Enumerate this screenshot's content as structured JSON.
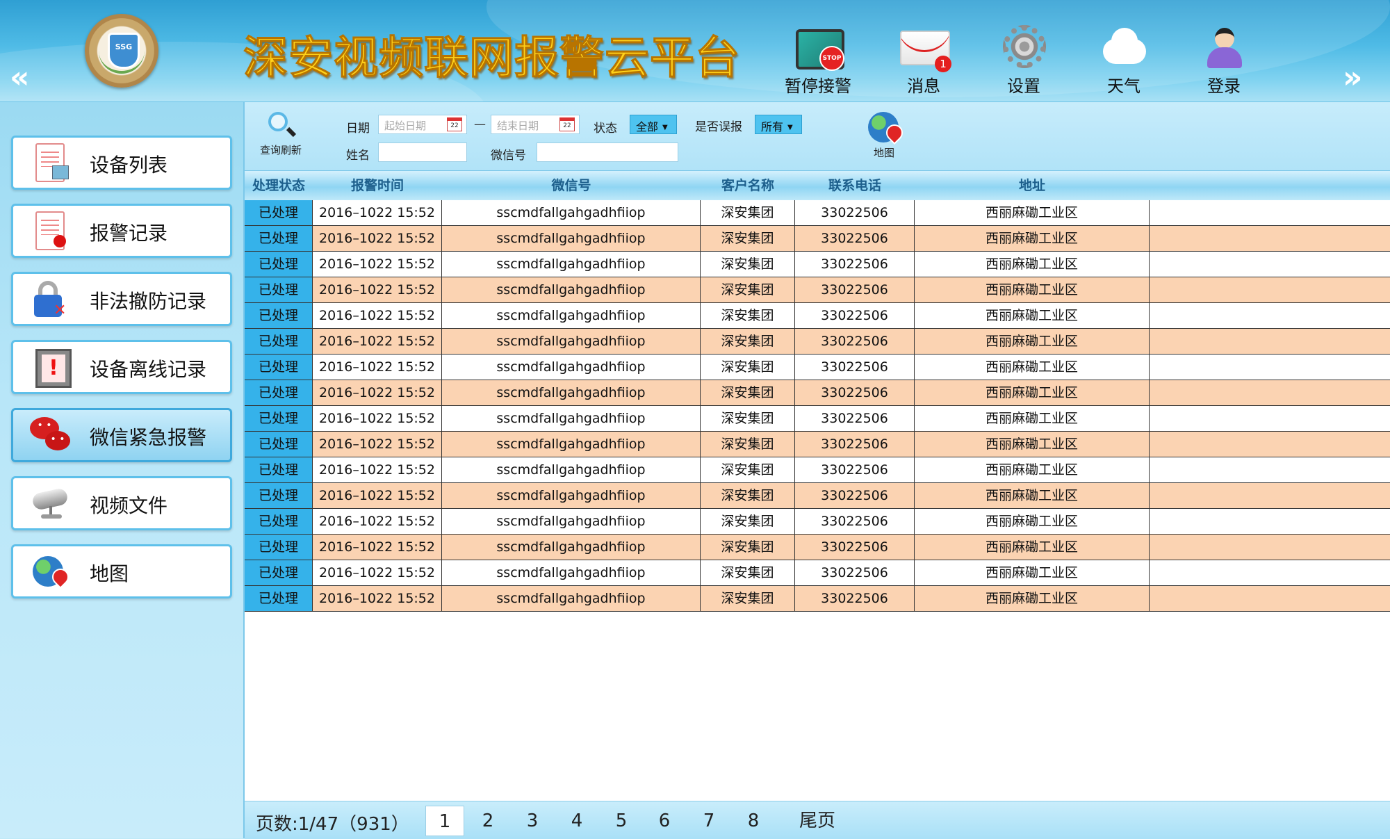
{
  "header": {
    "title": "深安视频联网报警云平台",
    "nav_prev": "«",
    "nav_next": "»",
    "buttons": [
      {
        "label": "暂停接警",
        "icon": "stop-screen-icon",
        "badge": "STOP"
      },
      {
        "label": "消息",
        "icon": "mail-icon",
        "count": "1"
      },
      {
        "label": "设置",
        "icon": "gear-icon"
      },
      {
        "label": "天气",
        "icon": "cloud-icon"
      },
      {
        "label": "登录",
        "icon": "user-icon"
      }
    ],
    "logo_text": "SSG"
  },
  "sidebar": {
    "items": [
      {
        "label": "设备列表",
        "icon": "device-list-icon"
      },
      {
        "label": "报警记录",
        "icon": "alarm-record-icon"
      },
      {
        "label": "非法撤防记录",
        "icon": "lock-icon"
      },
      {
        "label": "设备离线记录",
        "icon": "warning-icon"
      },
      {
        "label": "微信紧急报警",
        "icon": "chat-bubble-icon",
        "active": true
      },
      {
        "label": "视频文件",
        "icon": "camera-icon"
      },
      {
        "label": "地图",
        "icon": "globe-icon"
      }
    ]
  },
  "filters": {
    "refresh_label": "查询刷新",
    "date_label": "日期",
    "start_placeholder": "起始日期",
    "end_placeholder": "结束日期",
    "calendar_day": "22",
    "range_sep": "—",
    "status_label": "状态",
    "status_value": "全部",
    "false_alarm_label": "是否误报",
    "false_alarm_value": "所有",
    "map_label": "地图",
    "name_label": "姓名",
    "name_value": "",
    "wechat_label": "微信号",
    "wechat_value": ""
  },
  "table": {
    "columns": [
      "处理状态",
      "报警时间",
      "微信号",
      "客户名称",
      "联系电话",
      "地址"
    ],
    "rows": [
      [
        "已处理",
        "2016–1022 15:52",
        "sscmdfallgahgadhfiiop",
        "深安集团",
        "33022506",
        "西丽麻磡工业区"
      ],
      [
        "已处理",
        "2016–1022 15:52",
        "sscmdfallgahgadhfiiop",
        "深安集团",
        "33022506",
        "西丽麻磡工业区"
      ],
      [
        "已处理",
        "2016–1022 15:52",
        "sscmdfallgahgadhfiiop",
        "深安集团",
        "33022506",
        "西丽麻磡工业区"
      ],
      [
        "已处理",
        "2016–1022 15:52",
        "sscmdfallgahgadhfiiop",
        "深安集团",
        "33022506",
        "西丽麻磡工业区"
      ],
      [
        "已处理",
        "2016–1022 15:52",
        "sscmdfallgahgadhfiiop",
        "深安集团",
        "33022506",
        "西丽麻磡工业区"
      ],
      [
        "已处理",
        "2016–1022 15:52",
        "sscmdfallgahgadhfiiop",
        "深安集团",
        "33022506",
        "西丽麻磡工业区"
      ],
      [
        "已处理",
        "2016–1022 15:52",
        "sscmdfallgahgadhfiiop",
        "深安集团",
        "33022506",
        "西丽麻磡工业区"
      ],
      [
        "已处理",
        "2016–1022 15:52",
        "sscmdfallgahgadhfiiop",
        "深安集团",
        "33022506",
        "西丽麻磡工业区"
      ],
      [
        "已处理",
        "2016–1022 15:52",
        "sscmdfallgahgadhfiiop",
        "深安集团",
        "33022506",
        "西丽麻磡工业区"
      ],
      [
        "已处理",
        "2016–1022 15:52",
        "sscmdfallgahgadhfiiop",
        "深安集团",
        "33022506",
        "西丽麻磡工业区"
      ],
      [
        "已处理",
        "2016–1022 15:52",
        "sscmdfallgahgadhfiiop",
        "深安集团",
        "33022506",
        "西丽麻磡工业区"
      ],
      [
        "已处理",
        "2016–1022 15:52",
        "sscmdfallgahgadhfiiop",
        "深安集团",
        "33022506",
        "西丽麻磡工业区"
      ],
      [
        "已处理",
        "2016–1022 15:52",
        "sscmdfallgahgadhfiiop",
        "深安集团",
        "33022506",
        "西丽麻磡工业区"
      ],
      [
        "已处理",
        "2016–1022 15:52",
        "sscmdfallgahgadhfiiop",
        "深安集团",
        "33022506",
        "西丽麻磡工业区"
      ],
      [
        "已处理",
        "2016–1022 15:52",
        "sscmdfallgahgadhfiiop",
        "深安集团",
        "33022506",
        "西丽麻磡工业区"
      ],
      [
        "已处理",
        "2016–1022 15:52",
        "sscmdfallgahgadhfiiop",
        "深安集团",
        "33022506",
        "西丽麻磡工业区"
      ]
    ]
  },
  "pager": {
    "info": "页数:1/47（931）",
    "pages": [
      "1",
      "2",
      "3",
      "4",
      "5",
      "6",
      "7",
      "8"
    ],
    "current": "1",
    "last_label": "尾页"
  },
  "colors": {
    "status_cell": "#35b2ea",
    "row_alt": "#fbd3b2",
    "title_gold": "#ffd21a",
    "header_blue": "#2f9fd3"
  }
}
